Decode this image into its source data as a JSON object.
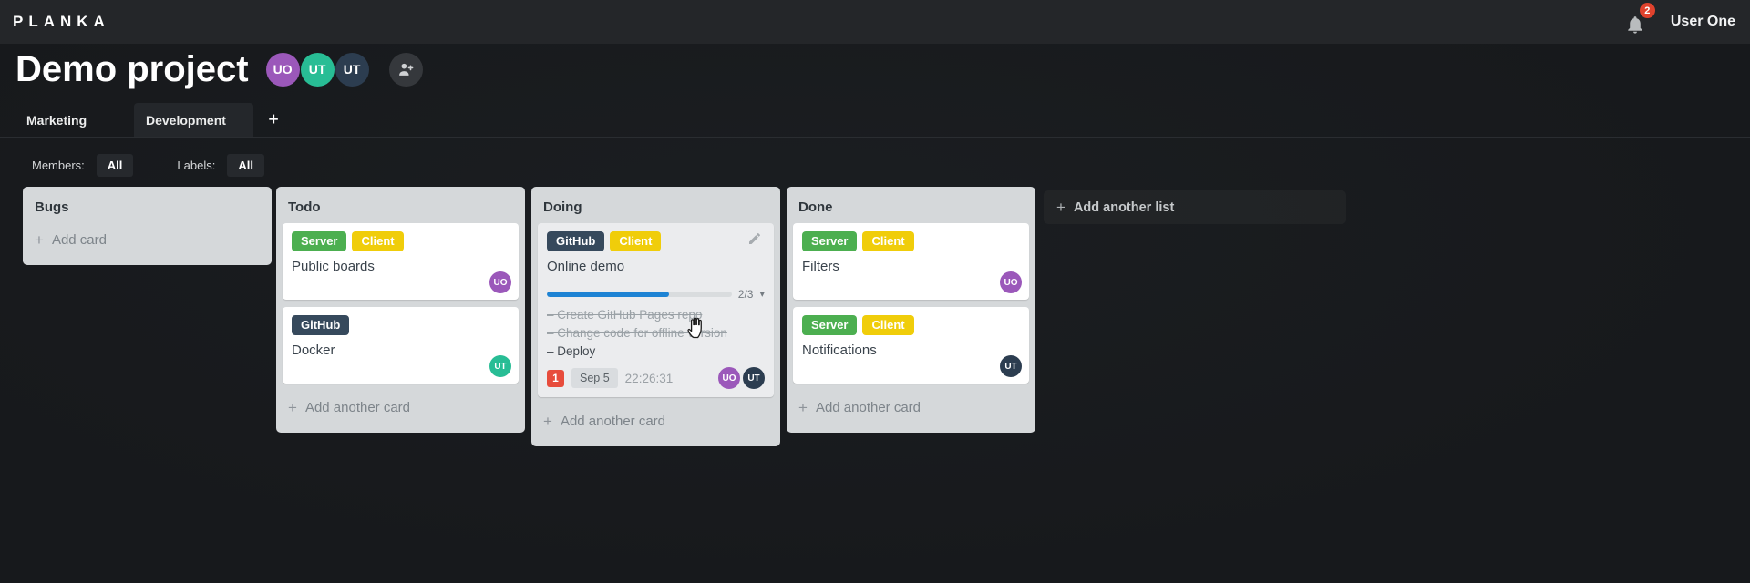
{
  "app": {
    "logo": "PLANKA",
    "notification_count": "2",
    "user_name": "User One"
  },
  "project": {
    "title": "Demo project",
    "members": [
      {
        "initials": "UO",
        "color": "#9b58ba"
      },
      {
        "initials": "UT",
        "color": "#28bd95"
      },
      {
        "initials": "UT",
        "color": "#2c3d50"
      }
    ]
  },
  "boards": {
    "tabs": [
      {
        "label": "Marketing",
        "active": false
      },
      {
        "label": "Development",
        "active": true
      }
    ],
    "add_label": "+"
  },
  "filters": {
    "members_label": "Members:",
    "members_value": "All",
    "labels_label": "Labels:",
    "labels_value": "All"
  },
  "board": {
    "lists": [
      {
        "title": "Bugs",
        "add_label": "Add card",
        "cards": []
      },
      {
        "title": "Todo",
        "add_label": "Add another card",
        "cards": [
          {
            "title": "Public boards",
            "labels": [
              {
                "text": "Server",
                "color": "#4caf50"
              },
              {
                "text": "Client",
                "color": "#f0cd0a"
              }
            ],
            "members": [
              {
                "initials": "UO",
                "color": "#9b58ba"
              }
            ]
          },
          {
            "title": "Docker",
            "labels": [
              {
                "text": "GitHub",
                "color": "#36495c"
              }
            ],
            "members": [
              {
                "initials": "UT",
                "color": "#28bd95"
              }
            ]
          }
        ]
      },
      {
        "title": "Doing",
        "add_label": "Add another card",
        "cards": [
          {
            "title": "Online demo",
            "hovered": true,
            "labels": [
              {
                "text": "GitHub",
                "color": "#36495c"
              },
              {
                "text": "Client",
                "color": "#f0cd0a"
              }
            ],
            "progress": {
              "completed": 2,
              "total": 3,
              "label": "2/3",
              "percent": 66,
              "color": "#1d83d4"
            },
            "tasks": [
              {
                "text": "Create GitHub Pages repo",
                "done": true
              },
              {
                "text": "Change code for offline version",
                "done": true
              },
              {
                "text": "Deploy",
                "done": false
              }
            ],
            "notification_count": "1",
            "due_date": "Sep 5",
            "timer": "22:26:31",
            "members": [
              {
                "initials": "UO",
                "color": "#9b58ba"
              },
              {
                "initials": "UT",
                "color": "#2c3d50"
              }
            ]
          }
        ]
      },
      {
        "title": "Done",
        "add_label": "Add another card",
        "cards": [
          {
            "title": "Filters",
            "labels": [
              {
                "text": "Server",
                "color": "#4caf50"
              },
              {
                "text": "Client",
                "color": "#f0cd0a"
              }
            ],
            "members": [
              {
                "initials": "UO",
                "color": "#9b58ba"
              }
            ]
          },
          {
            "title": "Notifications",
            "labels": [
              {
                "text": "Server",
                "color": "#4caf50"
              },
              {
                "text": "Client",
                "color": "#f0cd0a"
              }
            ],
            "members": [
              {
                "initials": "UT",
                "color": "#2c3d50"
              }
            ]
          }
        ]
      }
    ],
    "add_list_label": "Add another list"
  },
  "icons": {
    "add_glyph": "+",
    "caret_down_glyph": "▾",
    "task_dash": "–"
  }
}
